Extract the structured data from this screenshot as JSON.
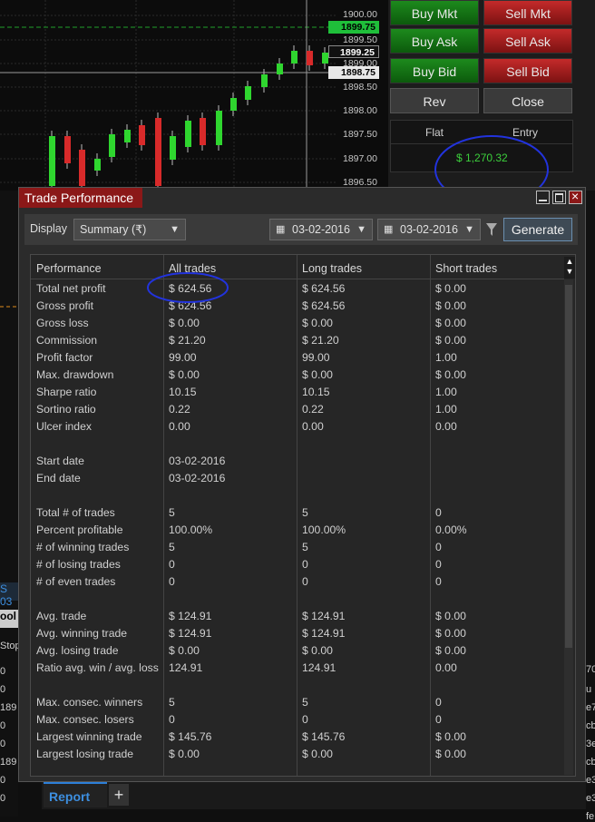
{
  "chart": {
    "price_labels": [
      "1900.00",
      "1899.50",
      "1899.00",
      "1898.50",
      "1898.00",
      "1897.50",
      "1897.00",
      "1896.50"
    ],
    "tag_top": "1899.75",
    "tag_mid": "1899.25",
    "tag_bottom": "1898.75",
    "tag_top_color": "#1fbf3a",
    "tag_bottom_color": "#e8e8e8"
  },
  "order_panel": {
    "buy_mkt": "Buy Mkt",
    "sell_mkt": "Sell Mkt",
    "buy_ask": "Buy Ask",
    "sell_ask": "Sell Ask",
    "buy_bid": "Buy Bid",
    "sell_bid": "Sell Bid",
    "rev": "Rev",
    "close": "Close",
    "flat": "Flat",
    "entry": "Entry",
    "pnl": "$ 1,270.32"
  },
  "dialog": {
    "title": "Trade Performance",
    "display_label": "Display",
    "display_value": "Summary (₹)",
    "date_from": "03-02-2016",
    "date_to": "03-02-2016",
    "generate": "Generate",
    "columns": [
      "Performance",
      "All trades",
      "Long trades",
      "Short trades"
    ],
    "rows": [
      [
        "Total net profit",
        "$ 624.56",
        "$ 624.56",
        "$ 0.00"
      ],
      [
        "Gross profit",
        "$ 624.56",
        "$ 624.56",
        "$ 0.00"
      ],
      [
        "Gross loss",
        "$ 0.00",
        "$ 0.00",
        "$ 0.00"
      ],
      [
        "Commission",
        "$ 21.20",
        "$ 21.20",
        "$ 0.00"
      ],
      [
        "Profit factor",
        "99.00",
        "99.00",
        "1.00"
      ],
      [
        "Max. drawdown",
        "$ 0.00",
        "$ 0.00",
        "$ 0.00"
      ],
      [
        "Sharpe ratio",
        "10.15",
        "10.15",
        "1.00"
      ],
      [
        "Sortino ratio",
        "0.22",
        "0.22",
        "1.00"
      ],
      [
        "Ulcer index",
        "0.00",
        "0.00",
        "0.00"
      ],
      [
        "",
        "",
        "",
        ""
      ],
      [
        "Start date",
        "03-02-2016",
        "",
        ""
      ],
      [
        "End date",
        "03-02-2016",
        "",
        ""
      ],
      [
        "",
        "",
        "",
        ""
      ],
      [
        "Total # of trades",
        "5",
        "5",
        "0"
      ],
      [
        "Percent profitable",
        "100.00%",
        "100.00%",
        "0.00%"
      ],
      [
        "# of winning trades",
        "5",
        "5",
        "0"
      ],
      [
        "# of losing trades",
        "0",
        "0",
        "0"
      ],
      [
        "# of even trades",
        "0",
        "0",
        "0"
      ],
      [
        "",
        "",
        "",
        ""
      ],
      [
        "Avg. trade",
        "$ 124.91",
        "$ 124.91",
        "$ 0.00"
      ],
      [
        "Avg. winning trade",
        "$ 124.91",
        "$ 124.91",
        "$ 0.00"
      ],
      [
        "Avg. losing trade",
        "$ 0.00",
        "$ 0.00",
        "$ 0.00"
      ],
      [
        "Ratio avg. win / avg. loss",
        "124.91",
        "124.91",
        "0.00"
      ],
      [
        "",
        "",
        "",
        ""
      ],
      [
        "Max. consec. winners",
        "5",
        "5",
        "0"
      ],
      [
        "Max. consec. losers",
        "0",
        "0",
        "0"
      ],
      [
        "Largest winning trade",
        "$ 145.76",
        "$ 145.76",
        "$ 0.00"
      ],
      [
        "Largest losing trade",
        "$ 0.00",
        "$ 0.00",
        "$ 0.00"
      ]
    ]
  },
  "tabs": {
    "report": "Report",
    "add": "+"
  },
  "background_left": [
    "S 03",
    "ool",
    "Stop",
    "0",
    "0",
    "189",
    "0",
    "0",
    "189",
    "0",
    "0"
  ],
  "background_right": [
    "70",
    "u",
    "e7",
    "cb",
    "3e",
    "cb",
    "e3",
    "e3",
    "fe"
  ],
  "annotation_color": "#2233dd"
}
